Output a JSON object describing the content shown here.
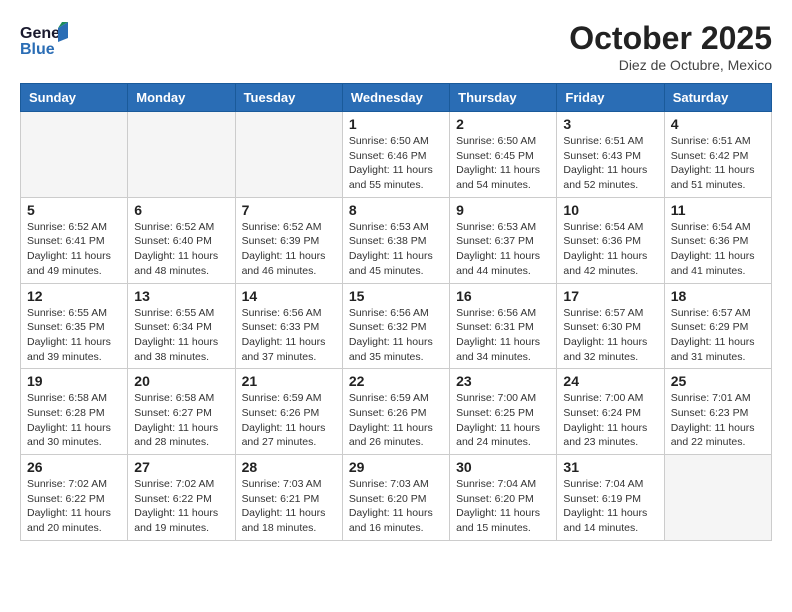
{
  "header": {
    "logo_line1": "General",
    "logo_line2": "Blue",
    "month": "October 2025",
    "location": "Diez de Octubre, Mexico"
  },
  "weekdays": [
    "Sunday",
    "Monday",
    "Tuesday",
    "Wednesday",
    "Thursday",
    "Friday",
    "Saturday"
  ],
  "weeks": [
    [
      {
        "day": "",
        "info": ""
      },
      {
        "day": "",
        "info": ""
      },
      {
        "day": "",
        "info": ""
      },
      {
        "day": "1",
        "info": "Sunrise: 6:50 AM\nSunset: 6:46 PM\nDaylight: 11 hours\nand 55 minutes."
      },
      {
        "day": "2",
        "info": "Sunrise: 6:50 AM\nSunset: 6:45 PM\nDaylight: 11 hours\nand 54 minutes."
      },
      {
        "day": "3",
        "info": "Sunrise: 6:51 AM\nSunset: 6:43 PM\nDaylight: 11 hours\nand 52 minutes."
      },
      {
        "day": "4",
        "info": "Sunrise: 6:51 AM\nSunset: 6:42 PM\nDaylight: 11 hours\nand 51 minutes."
      }
    ],
    [
      {
        "day": "5",
        "info": "Sunrise: 6:52 AM\nSunset: 6:41 PM\nDaylight: 11 hours\nand 49 minutes."
      },
      {
        "day": "6",
        "info": "Sunrise: 6:52 AM\nSunset: 6:40 PM\nDaylight: 11 hours\nand 48 minutes."
      },
      {
        "day": "7",
        "info": "Sunrise: 6:52 AM\nSunset: 6:39 PM\nDaylight: 11 hours\nand 46 minutes."
      },
      {
        "day": "8",
        "info": "Sunrise: 6:53 AM\nSunset: 6:38 PM\nDaylight: 11 hours\nand 45 minutes."
      },
      {
        "day": "9",
        "info": "Sunrise: 6:53 AM\nSunset: 6:37 PM\nDaylight: 11 hours\nand 44 minutes."
      },
      {
        "day": "10",
        "info": "Sunrise: 6:54 AM\nSunset: 6:36 PM\nDaylight: 11 hours\nand 42 minutes."
      },
      {
        "day": "11",
        "info": "Sunrise: 6:54 AM\nSunset: 6:36 PM\nDaylight: 11 hours\nand 41 minutes."
      }
    ],
    [
      {
        "day": "12",
        "info": "Sunrise: 6:55 AM\nSunset: 6:35 PM\nDaylight: 11 hours\nand 39 minutes."
      },
      {
        "day": "13",
        "info": "Sunrise: 6:55 AM\nSunset: 6:34 PM\nDaylight: 11 hours\nand 38 minutes."
      },
      {
        "day": "14",
        "info": "Sunrise: 6:56 AM\nSunset: 6:33 PM\nDaylight: 11 hours\nand 37 minutes."
      },
      {
        "day": "15",
        "info": "Sunrise: 6:56 AM\nSunset: 6:32 PM\nDaylight: 11 hours\nand 35 minutes."
      },
      {
        "day": "16",
        "info": "Sunrise: 6:56 AM\nSunset: 6:31 PM\nDaylight: 11 hours\nand 34 minutes."
      },
      {
        "day": "17",
        "info": "Sunrise: 6:57 AM\nSunset: 6:30 PM\nDaylight: 11 hours\nand 32 minutes."
      },
      {
        "day": "18",
        "info": "Sunrise: 6:57 AM\nSunset: 6:29 PM\nDaylight: 11 hours\nand 31 minutes."
      }
    ],
    [
      {
        "day": "19",
        "info": "Sunrise: 6:58 AM\nSunset: 6:28 PM\nDaylight: 11 hours\nand 30 minutes."
      },
      {
        "day": "20",
        "info": "Sunrise: 6:58 AM\nSunset: 6:27 PM\nDaylight: 11 hours\nand 28 minutes."
      },
      {
        "day": "21",
        "info": "Sunrise: 6:59 AM\nSunset: 6:26 PM\nDaylight: 11 hours\nand 27 minutes."
      },
      {
        "day": "22",
        "info": "Sunrise: 6:59 AM\nSunset: 6:26 PM\nDaylight: 11 hours\nand 26 minutes."
      },
      {
        "day": "23",
        "info": "Sunrise: 7:00 AM\nSunset: 6:25 PM\nDaylight: 11 hours\nand 24 minutes."
      },
      {
        "day": "24",
        "info": "Sunrise: 7:00 AM\nSunset: 6:24 PM\nDaylight: 11 hours\nand 23 minutes."
      },
      {
        "day": "25",
        "info": "Sunrise: 7:01 AM\nSunset: 6:23 PM\nDaylight: 11 hours\nand 22 minutes."
      }
    ],
    [
      {
        "day": "26",
        "info": "Sunrise: 7:02 AM\nSunset: 6:22 PM\nDaylight: 11 hours\nand 20 minutes."
      },
      {
        "day": "27",
        "info": "Sunrise: 7:02 AM\nSunset: 6:22 PM\nDaylight: 11 hours\nand 19 minutes."
      },
      {
        "day": "28",
        "info": "Sunrise: 7:03 AM\nSunset: 6:21 PM\nDaylight: 11 hours\nand 18 minutes."
      },
      {
        "day": "29",
        "info": "Sunrise: 7:03 AM\nSunset: 6:20 PM\nDaylight: 11 hours\nand 16 minutes."
      },
      {
        "day": "30",
        "info": "Sunrise: 7:04 AM\nSunset: 6:20 PM\nDaylight: 11 hours\nand 15 minutes."
      },
      {
        "day": "31",
        "info": "Sunrise: 7:04 AM\nSunset: 6:19 PM\nDaylight: 11 hours\nand 14 minutes."
      },
      {
        "day": "",
        "info": ""
      }
    ]
  ]
}
